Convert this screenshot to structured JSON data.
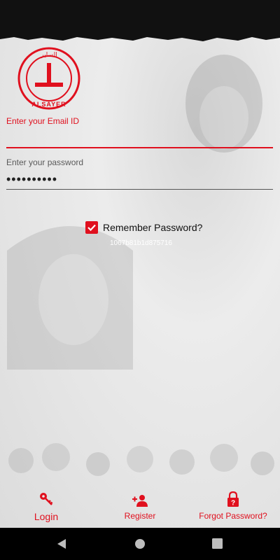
{
  "brand": {
    "logo_text": "ALSAYER",
    "logo_arabic": "الساير"
  },
  "form": {
    "email_label": "Enter your Email ID",
    "email_value": "",
    "password_label": "Enter your password",
    "password_value": "••••••••••",
    "remember_label": "Remember Password?",
    "remember_checked": true,
    "device_id": "1067b81b1d875716"
  },
  "nav": {
    "login_label": "Login",
    "register_label": "Register",
    "forgot_label": "Forgot Password?"
  },
  "colors": {
    "accent": "#e0101e",
    "background": "#e8e8e8"
  },
  "icons": [
    "key-icon",
    "add-person-icon",
    "lock-question-icon",
    "back-icon",
    "home-icon",
    "recents-icon"
  ]
}
